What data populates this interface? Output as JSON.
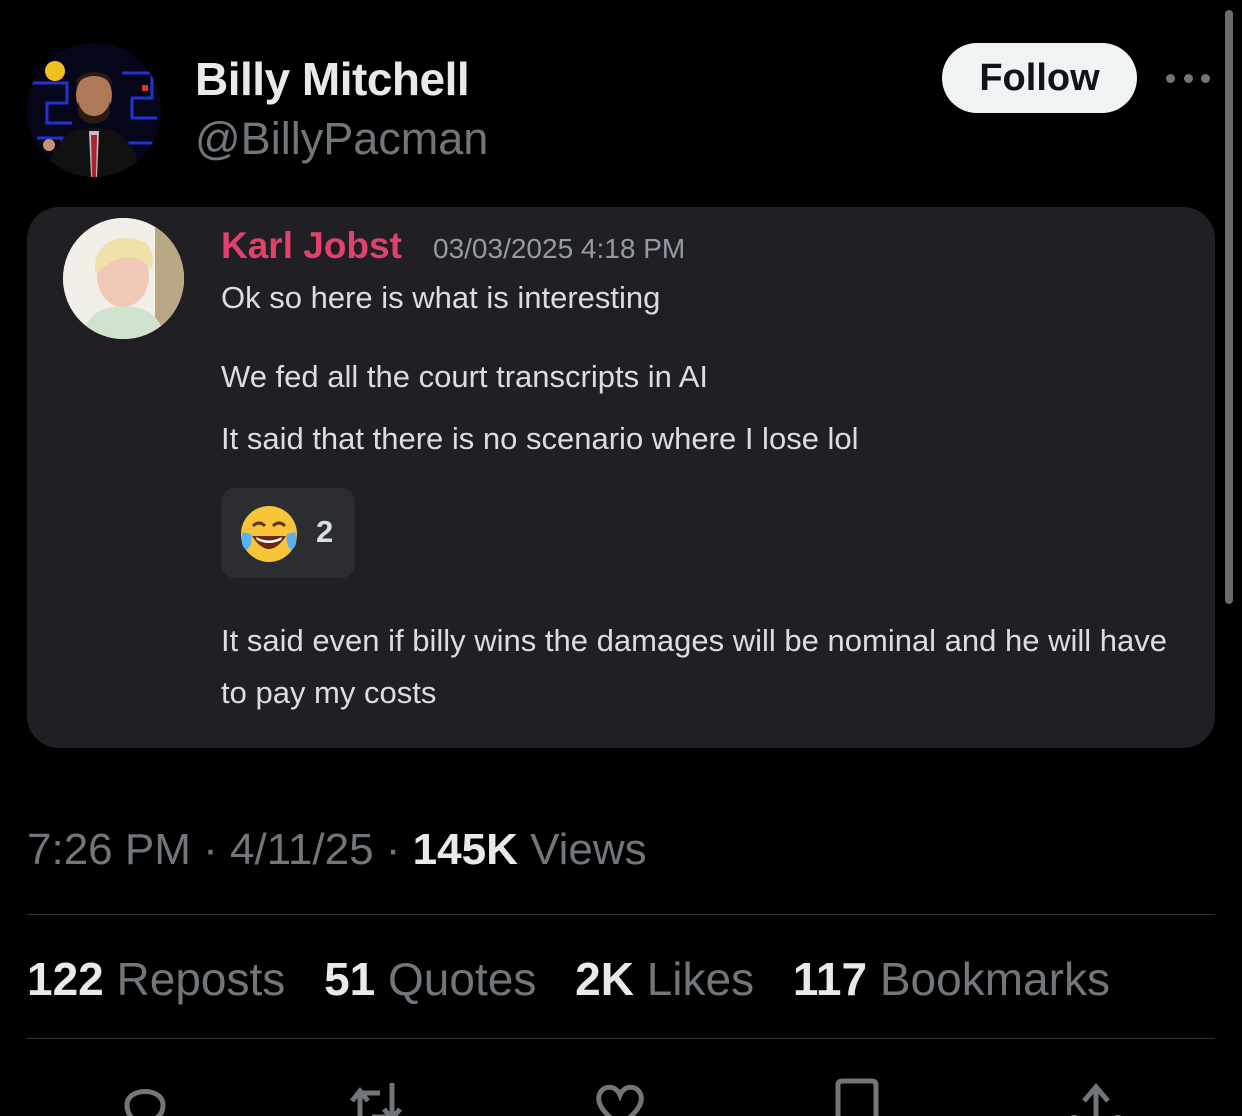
{
  "tweet": {
    "author": {
      "display_name": "Billy Mitchell",
      "handle": "@BillyPacman"
    },
    "follow_label": "Follow",
    "time": "7:26 PM",
    "date": "4/11/25",
    "separator": "·",
    "views_count": "145K",
    "views_label": "Views"
  },
  "embedded_message": {
    "author": "Karl Jobst",
    "author_color": "#e0426b",
    "timestamp": "03/03/2025 4:18 PM",
    "lines": [
      "Ok so here is what is interesting",
      "We fed all the court transcripts in AI",
      "It said that there is no scenario where I lose lol",
      "It said even if billy wins the damages will be nominal and he will have to pay my costs"
    ],
    "reaction": {
      "emoji_icon": "face-with-tears-of-joy-icon",
      "count": "2"
    }
  },
  "stats": [
    {
      "count": "122",
      "label": "Reposts"
    },
    {
      "count": "51",
      "label": "Quotes"
    },
    {
      "count": "2K",
      "label": "Likes"
    },
    {
      "count": "117",
      "label": "Bookmarks"
    }
  ],
  "actions": [
    "reply-icon",
    "repost-icon",
    "like-icon",
    "bookmark-icon",
    "share-icon"
  ]
}
